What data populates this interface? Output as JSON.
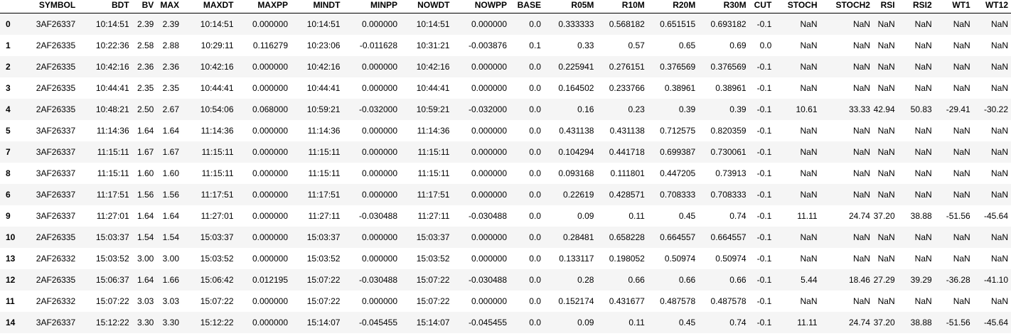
{
  "table": {
    "columns": [
      "SYMBOL",
      "BDT",
      "BV",
      "MAX",
      "MAXDT",
      "MAXPP",
      "MINDT",
      "MINPP",
      "NOWDT",
      "NOWPP",
      "BASE",
      "R05M",
      "R10M",
      "R20M",
      "R30M",
      "CUT",
      "STOCH",
      "STOCH2",
      "RSI",
      "RSI2",
      "WT1",
      "WT12"
    ],
    "rows": [
      {
        "index": "0",
        "cells": [
          "3AF26337",
          "10:14:51",
          "2.39",
          "2.39",
          "10:14:51",
          "0.000000",
          "10:14:51",
          "0.000000",
          "10:14:51",
          "0.000000",
          "0.0",
          "0.333333",
          "0.568182",
          "0.651515",
          "0.693182",
          "-0.1",
          "NaN",
          "NaN",
          "NaN",
          "NaN",
          "NaN",
          "NaN"
        ]
      },
      {
        "index": "1",
        "cells": [
          "2AF26335",
          "10:22:36",
          "2.58",
          "2.88",
          "10:29:11",
          "0.116279",
          "10:23:06",
          "-0.011628",
          "10:31:21",
          "-0.003876",
          "0.1",
          "0.33",
          "0.57",
          "0.65",
          "0.69",
          "0.0",
          "NaN",
          "NaN",
          "NaN",
          "NaN",
          "NaN",
          "NaN"
        ]
      },
      {
        "index": "2",
        "cells": [
          "2AF26335",
          "10:42:16",
          "2.36",
          "2.36",
          "10:42:16",
          "0.000000",
          "10:42:16",
          "0.000000",
          "10:42:16",
          "0.000000",
          "0.0",
          "0.225941",
          "0.276151",
          "0.376569",
          "0.376569",
          "-0.1",
          "NaN",
          "NaN",
          "NaN",
          "NaN",
          "NaN",
          "NaN"
        ]
      },
      {
        "index": "3",
        "cells": [
          "2AF26335",
          "10:44:41",
          "2.35",
          "2.35",
          "10:44:41",
          "0.000000",
          "10:44:41",
          "0.000000",
          "10:44:41",
          "0.000000",
          "0.0",
          "0.164502",
          "0.233766",
          "0.38961",
          "0.38961",
          "-0.1",
          "NaN",
          "NaN",
          "NaN",
          "NaN",
          "NaN",
          "NaN"
        ]
      },
      {
        "index": "4",
        "cells": [
          "2AF26335",
          "10:48:21",
          "2.50",
          "2.67",
          "10:54:06",
          "0.068000",
          "10:59:21",
          "-0.032000",
          "10:59:21",
          "-0.032000",
          "0.0",
          "0.16",
          "0.23",
          "0.39",
          "0.39",
          "-0.1",
          "10.61",
          "33.33",
          "42.94",
          "50.83",
          "-29.41",
          "-30.22"
        ]
      },
      {
        "index": "5",
        "cells": [
          "3AF26337",
          "11:14:36",
          "1.64",
          "1.64",
          "11:14:36",
          "0.000000",
          "11:14:36",
          "0.000000",
          "11:14:36",
          "0.000000",
          "0.0",
          "0.431138",
          "0.431138",
          "0.712575",
          "0.820359",
          "-0.1",
          "NaN",
          "NaN",
          "NaN",
          "NaN",
          "NaN",
          "NaN"
        ]
      },
      {
        "index": "7",
        "cells": [
          "3AF26337",
          "11:15:11",
          "1.67",
          "1.67",
          "11:15:11",
          "0.000000",
          "11:15:11",
          "0.000000",
          "11:15:11",
          "0.000000",
          "0.0",
          "0.104294",
          "0.441718",
          "0.699387",
          "0.730061",
          "-0.1",
          "NaN",
          "NaN",
          "NaN",
          "NaN",
          "NaN",
          "NaN"
        ]
      },
      {
        "index": "8",
        "cells": [
          "3AF26337",
          "11:15:11",
          "1.60",
          "1.60",
          "11:15:11",
          "0.000000",
          "11:15:11",
          "0.000000",
          "11:15:11",
          "0.000000",
          "0.0",
          "0.093168",
          "0.111801",
          "0.447205",
          "0.73913",
          "-0.1",
          "NaN",
          "NaN",
          "NaN",
          "NaN",
          "NaN",
          "NaN"
        ]
      },
      {
        "index": "6",
        "cells": [
          "3AF26337",
          "11:17:51",
          "1.56",
          "1.56",
          "11:17:51",
          "0.000000",
          "11:17:51",
          "0.000000",
          "11:17:51",
          "0.000000",
          "0.0",
          "0.22619",
          "0.428571",
          "0.708333",
          "0.708333",
          "-0.1",
          "NaN",
          "NaN",
          "NaN",
          "NaN",
          "NaN",
          "NaN"
        ]
      },
      {
        "index": "9",
        "cells": [
          "3AF26337",
          "11:27:01",
          "1.64",
          "1.64",
          "11:27:01",
          "0.000000",
          "11:27:11",
          "-0.030488",
          "11:27:11",
          "-0.030488",
          "0.0",
          "0.09",
          "0.11",
          "0.45",
          "0.74",
          "-0.1",
          "11.11",
          "24.74",
          "37.20",
          "38.88",
          "-51.56",
          "-45.64"
        ]
      },
      {
        "index": "10",
        "cells": [
          "2AF26335",
          "15:03:37",
          "1.54",
          "1.54",
          "15:03:37",
          "0.000000",
          "15:03:37",
          "0.000000",
          "15:03:37",
          "0.000000",
          "0.0",
          "0.28481",
          "0.658228",
          "0.664557",
          "0.664557",
          "-0.1",
          "NaN",
          "NaN",
          "NaN",
          "NaN",
          "NaN",
          "NaN"
        ]
      },
      {
        "index": "13",
        "cells": [
          "2AF26332",
          "15:03:52",
          "3.00",
          "3.00",
          "15:03:52",
          "0.000000",
          "15:03:52",
          "0.000000",
          "15:03:52",
          "0.000000",
          "0.0",
          "0.133117",
          "0.198052",
          "0.50974",
          "0.50974",
          "-0.1",
          "NaN",
          "NaN",
          "NaN",
          "NaN",
          "NaN",
          "NaN"
        ]
      },
      {
        "index": "12",
        "cells": [
          "2AF26335",
          "15:06:37",
          "1.64",
          "1.66",
          "15:06:42",
          "0.012195",
          "15:07:22",
          "-0.030488",
          "15:07:22",
          "-0.030488",
          "0.0",
          "0.28",
          "0.66",
          "0.66",
          "0.66",
          "-0.1",
          "5.44",
          "18.46",
          "27.29",
          "39.29",
          "-36.28",
          "-41.10"
        ]
      },
      {
        "index": "11",
        "cells": [
          "2AF26332",
          "15:07:22",
          "3.03",
          "3.03",
          "15:07:22",
          "0.000000",
          "15:07:22",
          "0.000000",
          "15:07:22",
          "0.000000",
          "0.0",
          "0.152174",
          "0.431677",
          "0.487578",
          "0.487578",
          "-0.1",
          "NaN",
          "NaN",
          "NaN",
          "NaN",
          "NaN",
          "NaN"
        ]
      },
      {
        "index": "14",
        "cells": [
          "3AF26337",
          "15:12:22",
          "3.30",
          "3.30",
          "15:12:22",
          "0.000000",
          "15:14:07",
          "-0.045455",
          "15:14:07",
          "-0.045455",
          "0.0",
          "0.09",
          "0.11",
          "0.45",
          "0.74",
          "-0.1",
          "11.11",
          "24.74",
          "37.20",
          "38.88",
          "-51.56",
          "-45.64"
        ]
      }
    ]
  }
}
